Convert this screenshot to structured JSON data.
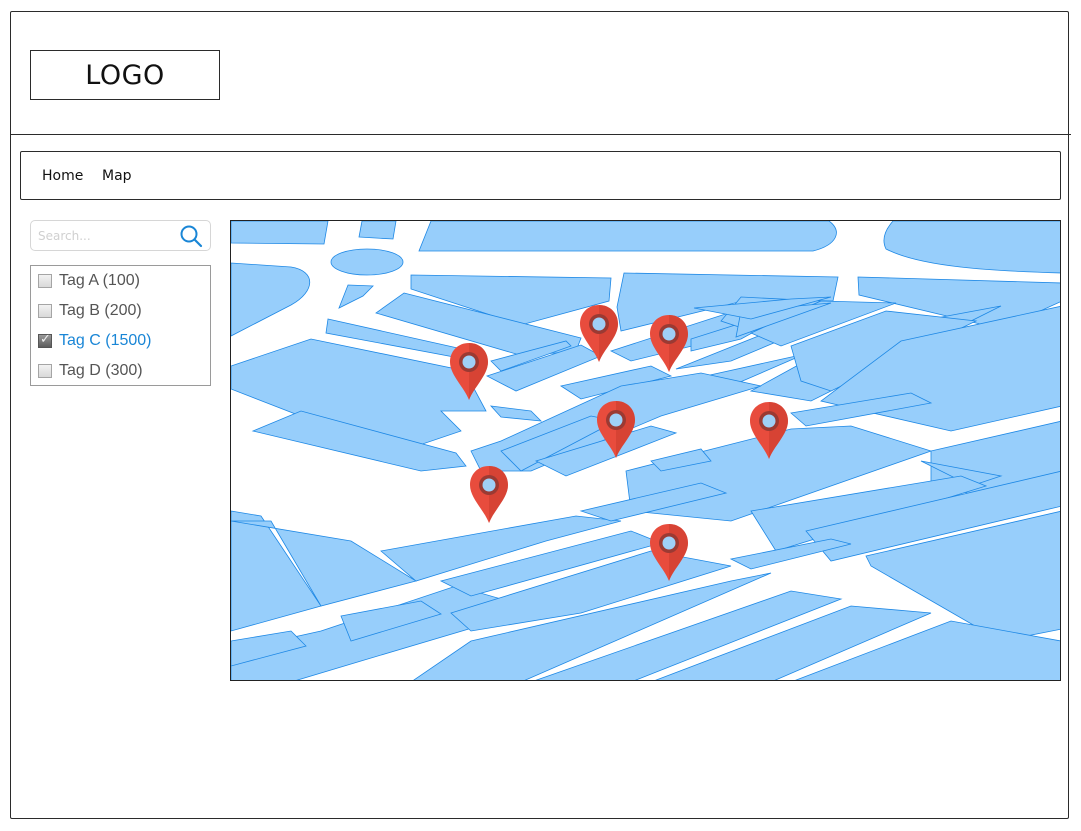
{
  "header": {
    "logo_text": "LOGO"
  },
  "nav": {
    "items": [
      {
        "label": "Home"
      },
      {
        "label": "Map"
      }
    ]
  },
  "search": {
    "placeholder": "Search...",
    "value": ""
  },
  "tags": [
    {
      "label": "Tag A (100)",
      "checked": false
    },
    {
      "label": "Tag B (200)",
      "checked": false
    },
    {
      "label": "Tag C (1500)",
      "checked": true
    },
    {
      "label": "Tag D (300)",
      "checked": false
    }
  ],
  "map": {
    "marker_count": 7,
    "colors": {
      "block": "#97cefb",
      "block_border": "#1e88e5",
      "road": "#ffffff",
      "marker": "#e84c3d",
      "marker_dark": "#c0392b"
    }
  },
  "colors": {
    "accent": "#1a86d6",
    "frame": "#2b2b2b"
  },
  "icons": {
    "search": "search-icon",
    "check": "check-mark-icon",
    "marker": "map-marker-icon"
  }
}
